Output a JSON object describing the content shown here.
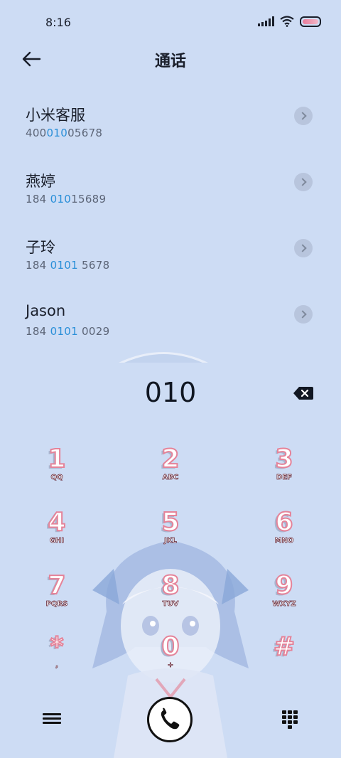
{
  "status": {
    "time": "8:16"
  },
  "header": {
    "title": "通话"
  },
  "contacts": [
    {
      "name": "小米客服",
      "number_pre": "400",
      "number_hl": "010",
      "number_post": "05678"
    },
    {
      "name": "燕婷",
      "number_pre": "184 ",
      "number_hl": "010",
      "number_post": "15689"
    },
    {
      "name": "子玲",
      "number_pre": "184 ",
      "number_hl": "0101",
      "number_post": " 5678"
    },
    {
      "name": "Jason",
      "number_pre": "184 ",
      "number_hl": "0101",
      "number_post": " 0029"
    }
  ],
  "dialer": {
    "input": "010"
  },
  "keypad": [
    {
      "digit": "1",
      "letters": "QQ"
    },
    {
      "digit": "2",
      "letters": "ABC"
    },
    {
      "digit": "3",
      "letters": "DEF"
    },
    {
      "digit": "4",
      "letters": "GHI"
    },
    {
      "digit": "5",
      "letters": "JKL"
    },
    {
      "digit": "6",
      "letters": "MNO"
    },
    {
      "digit": "7",
      "letters": "PQRS"
    },
    {
      "digit": "8",
      "letters": "TUV"
    },
    {
      "digit": "9",
      "letters": "WXYZ"
    },
    {
      "digit": "*",
      "letters": ","
    },
    {
      "digit": "0",
      "letters": "+"
    },
    {
      "digit": "#",
      "letters": ""
    }
  ],
  "icons": {
    "back": "arrow-left-icon",
    "chevron": "chevron-right-icon",
    "backspace": "backspace-icon",
    "menu": "menu-icon",
    "call": "phone-icon",
    "keypad": "dialpad-icon"
  },
  "colors": {
    "background": "#cddcf4",
    "highlight": "#2a8fd8",
    "digit_outline": "#e58399",
    "text": "#1a1f2b"
  }
}
